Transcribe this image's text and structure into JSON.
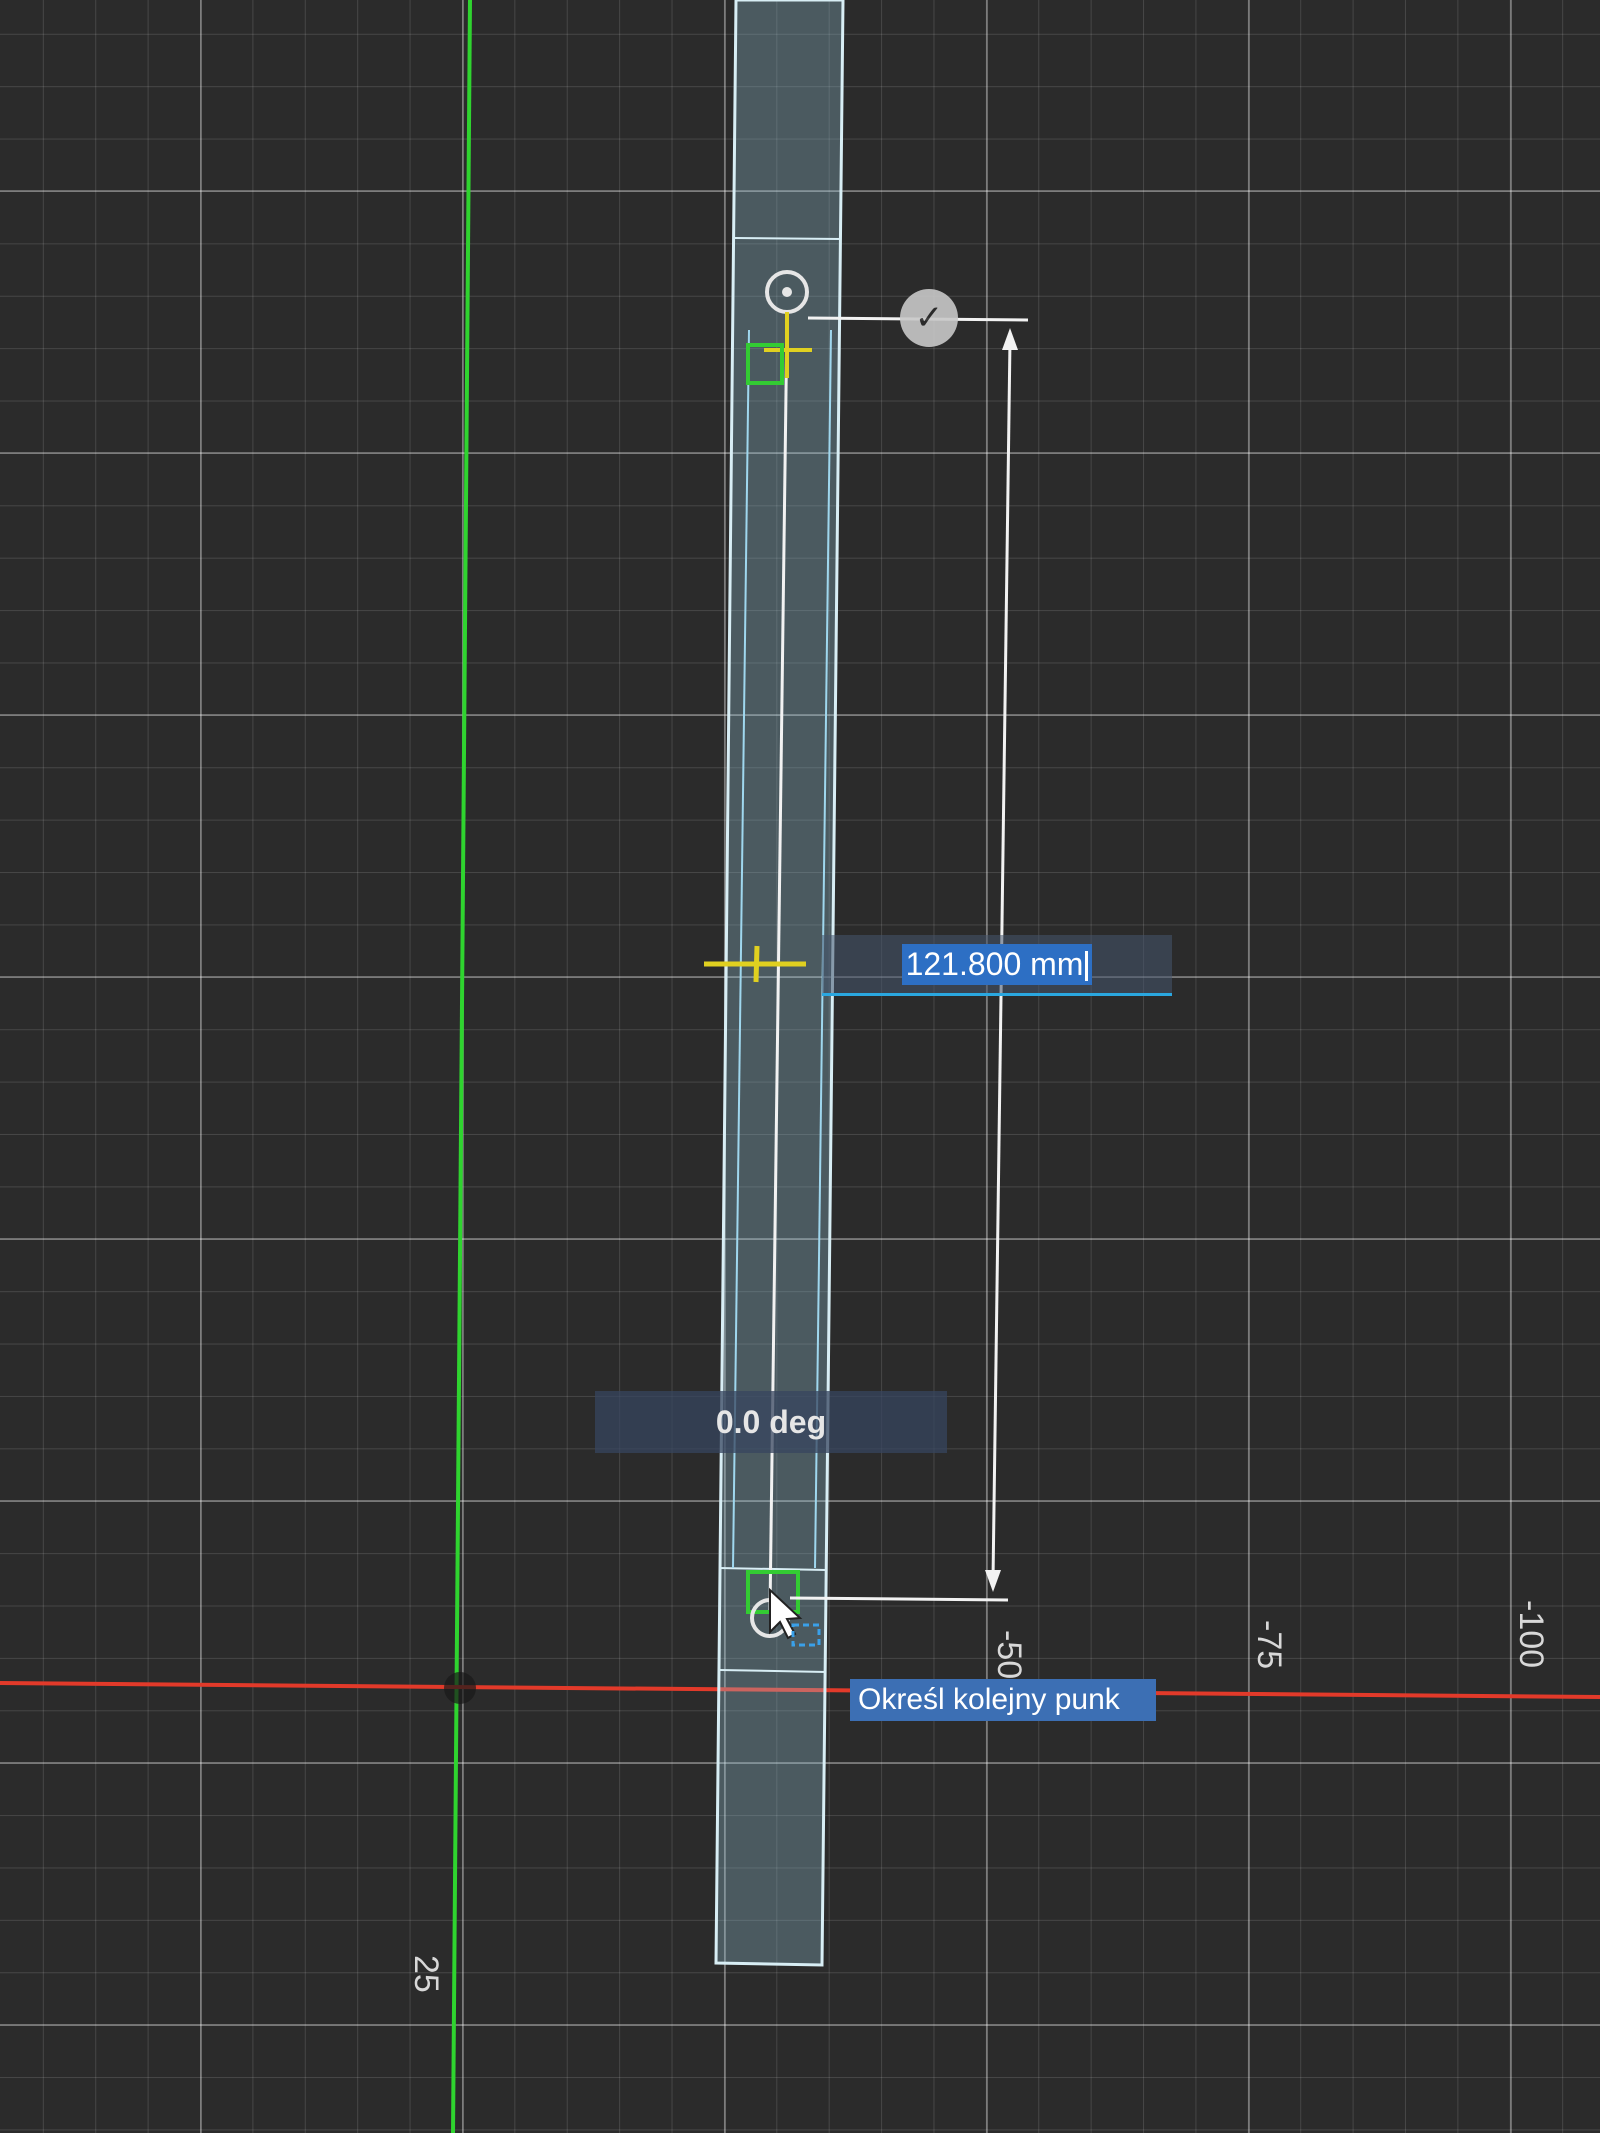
{
  "viewport": {
    "axis_labels": [
      "-50",
      "-75",
      "-100",
      "25"
    ],
    "x_axis_color": "#e03030",
    "y_axis_color": "#33cc33",
    "grid_color": "#bfbfbf",
    "background_color": "#2b2b2b"
  },
  "sketch": {
    "length_dimension": {
      "value": "121.800 mm"
    },
    "angle_dimension": {
      "value": "0.0 deg"
    },
    "prompt": {
      "text": "Określ kolejny punk"
    },
    "confirm_icon": "checkmark-icon",
    "colors": {
      "body": "#9fc8d8",
      "accent": "#2d6fc4",
      "point_marker": "#e0d020",
      "constraint": "#33cc33"
    }
  }
}
